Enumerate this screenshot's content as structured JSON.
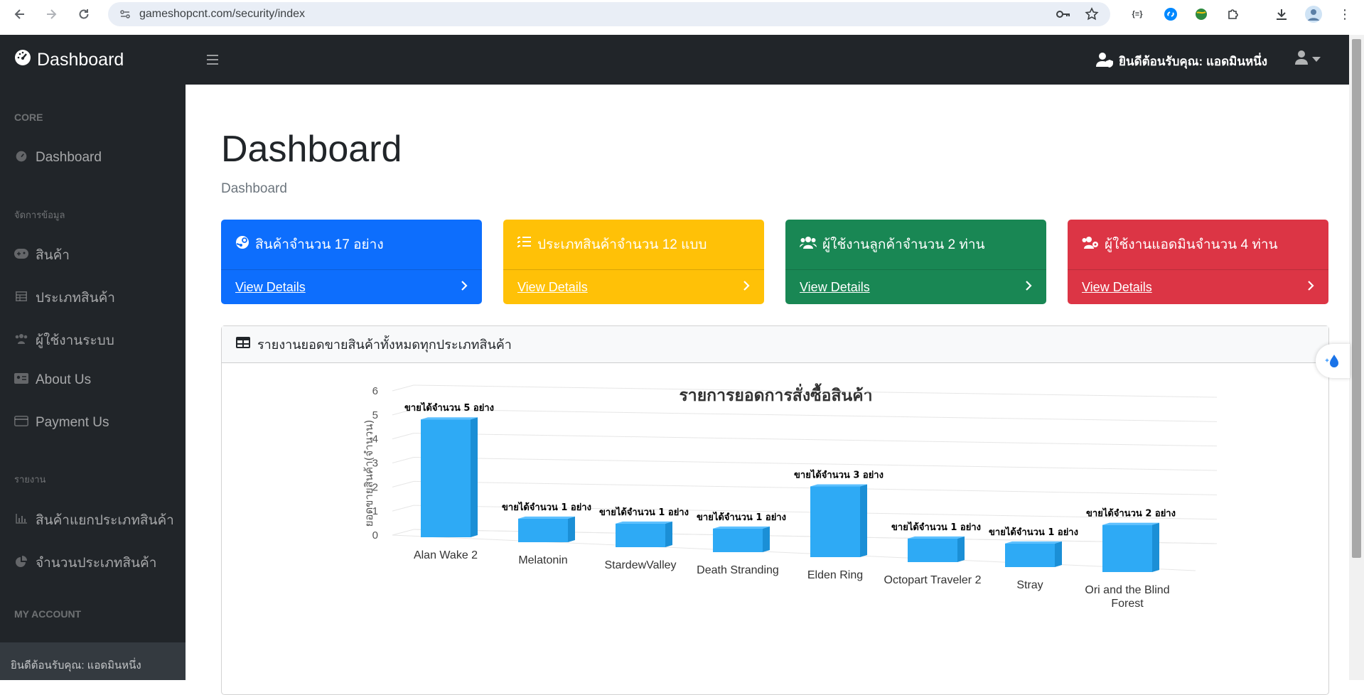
{
  "browser": {
    "url": "gameshopcnt.com/security/index"
  },
  "navbar": {
    "brand": "Dashboard",
    "welcome": "ยินดีต้อนรับคุณ: แอดมินหนึ่ง"
  },
  "sidebar": {
    "sections": [
      {
        "heading": "CORE"
      },
      {
        "heading": "จัดการข้อมูล"
      },
      {
        "heading": "รายงาน"
      },
      {
        "heading": "MY ACCOUNT"
      }
    ],
    "items": [
      {
        "label": "Dashboard",
        "icon": "tachometer-icon"
      },
      {
        "label": "สินค้า",
        "icon": "gamepad-icon"
      },
      {
        "label": "ประเภทสินค้า",
        "icon": "table-icon"
      },
      {
        "label": "ผู้ใช้งานระบบ",
        "icon": "users-icon"
      },
      {
        "label": "About Us",
        "icon": "id-card-icon"
      },
      {
        "label": "Payment Us",
        "icon": "credit-card-icon"
      },
      {
        "label": "สินค้าแยกประเภทสินค้า",
        "icon": "bar-chart-icon"
      },
      {
        "label": "จำนวนประเภทสินค้า",
        "icon": "pie-chart-icon"
      }
    ],
    "footer": "ยินดีต้อนรับคุณ: แอดมินหนึ่ง"
  },
  "page": {
    "title": "Dashboard",
    "breadcrumb": "Dashboard"
  },
  "cards": [
    {
      "text": "สินค้าจำนวน 17 อย่าง",
      "link": "View Details",
      "color": "#0d6efd"
    },
    {
      "text": "ประเภทสินค้าจำนวน 12 แบบ",
      "link": "View Details",
      "color": "#ffc107"
    },
    {
      "text": "ผู้ใช้งานลูกค้าจำนวน 2 ท่าน",
      "link": "View Details",
      "color": "#198754"
    },
    {
      "text": "ผู้ใช้งานแอดมินจำนวน 4 ท่าน",
      "link": "View Details",
      "color": "#dc3545"
    }
  ],
  "report": {
    "header": "รายงานยอดขายสินค้าทั้งหมดทุกประเภทสินค้า"
  },
  "chart_data": {
    "type": "bar",
    "title": "รายการยอดการสั่งซื้อสินค้า",
    "ylabel": "ยอดขายสินค้า(จำนวน)",
    "xlabel": "",
    "ylim": [
      0,
      6
    ],
    "yticks": [
      0,
      1,
      2,
      3,
      4,
      5,
      6
    ],
    "grid": true,
    "three_d": true,
    "bar_color": "#2eaaf5",
    "categories": [
      "Alan Wake 2",
      "Melatonin",
      "StardewValley",
      "Death Stranding",
      "Elden Ring",
      "Octopart Traveler 2",
      "Stray",
      "Ori and the Blind Forest"
    ],
    "values": [
      5,
      1,
      1,
      1,
      3,
      1,
      1,
      2
    ],
    "data_labels": [
      "ขายได้จำนวน 5 อย่าง",
      "ขายได้จำนวน 1 อย่าง",
      "ขายได้จำนวน 1 อย่าง",
      "ขายได้จำนวน 1 อย่าง",
      "ขายได้จำนวน 3 อย่าง",
      "ขายได้จำนวน 1 อย่าง",
      "ขายได้จำนวน 1 อย่าง",
      "ขายได้จำนวน 2 อย่าง"
    ]
  }
}
